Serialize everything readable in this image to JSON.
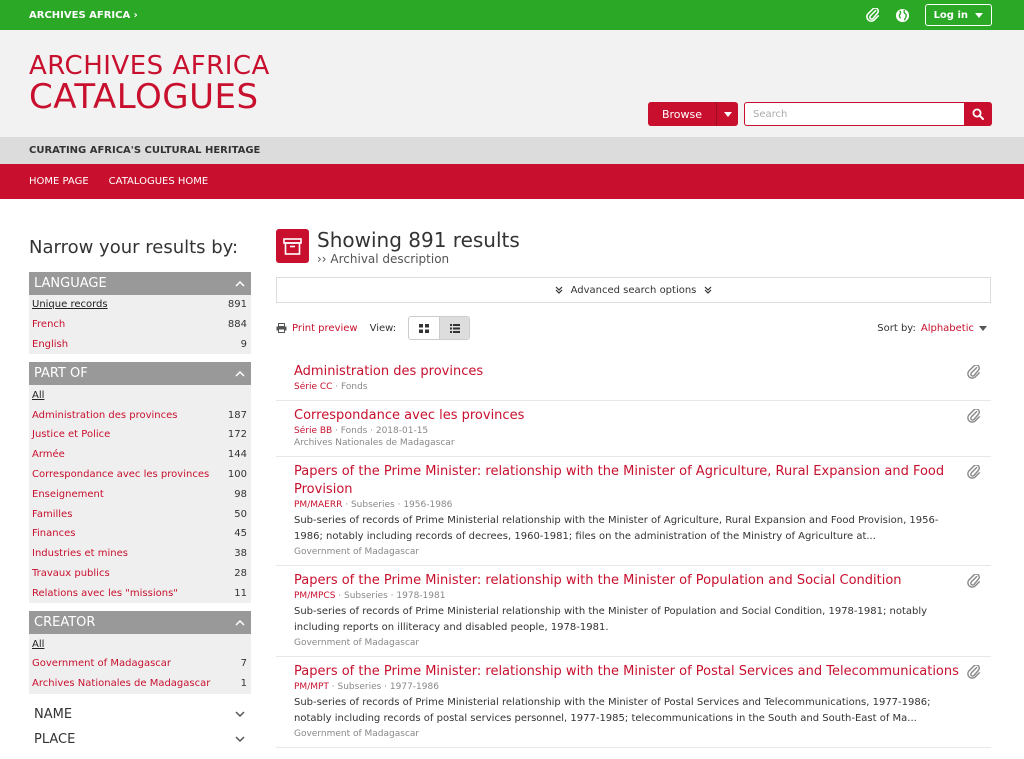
{
  "topbar": {
    "site": "ARCHIVES AFRICA ›",
    "login": "Log in"
  },
  "logo": {
    "line1": "ARCHIVES AFRICA",
    "line2": "CATALOGUES"
  },
  "browse": {
    "label": "Browse"
  },
  "search": {
    "placeholder": "Search"
  },
  "tagline": "CURATING AFRICA'S CULTURAL HERITAGE",
  "nav": {
    "home": "HOME PAGE",
    "catalogues": "CATALOGUES HOME"
  },
  "sidebar": {
    "heading": "Narrow your results by:",
    "language": {
      "title": "LANGUAGE",
      "items": [
        {
          "label": "Unique records",
          "count": "891"
        },
        {
          "label": "French",
          "count": "884"
        },
        {
          "label": "English",
          "count": "9"
        }
      ]
    },
    "partof": {
      "title": "PART OF",
      "all": "All",
      "items": [
        {
          "label": "Administration des provinces",
          "count": "187"
        },
        {
          "label": "Justice et Police",
          "count": "172"
        },
        {
          "label": "Armée",
          "count": "144"
        },
        {
          "label": "Correspondance avec les provinces",
          "count": "100"
        },
        {
          "label": "Enseignement",
          "count": "98"
        },
        {
          "label": "Familles",
          "count": "50"
        },
        {
          "label": "Finances",
          "count": "45"
        },
        {
          "label": "Industries et mines",
          "count": "38"
        },
        {
          "label": "Travaux publics",
          "count": "28"
        },
        {
          "label": "Relations avec les \"missions\"",
          "count": "11"
        }
      ]
    },
    "creator": {
      "title": "CREATOR",
      "all": "All",
      "items": [
        {
          "label": "Government of Madagascar",
          "count": "7"
        },
        {
          "label": "Archives Nationales de Madagascar",
          "count": "1"
        }
      ]
    },
    "name": "NAME",
    "place": "PLACE"
  },
  "content": {
    "title": "Showing 891 results",
    "subtitle": "›› Archival description",
    "advanced": "Advanced search options",
    "print": "Print preview",
    "view": "View:",
    "sort_label": "Sort by:",
    "sort_value": "Alphabetic"
  },
  "results": [
    {
      "title": "Administration des provinces",
      "ref": "Série CC",
      "level": "Fonds",
      "date": "",
      "desc": "",
      "creator": ""
    },
    {
      "title": "Correspondance avec les provinces",
      "ref": "Série BB",
      "level": "Fonds",
      "date": "2018-01-15",
      "desc": "",
      "creator": "Archives Nationales de Madagascar"
    },
    {
      "title": "Papers of the Prime Minister: relationship with the Minister of Agriculture, Rural Expansion and Food Provision",
      "ref": "PM/MAERR",
      "level": "Subseries",
      "date": "1956-1986",
      "desc": "Sub-series of records of Prime Ministerial relationship with the Minister of Agriculture, Rural Expansion and Food Provision, 1956-1986; notably including records of decrees, 1960-1981; files on the administration of the Ministry of Agriculture at...",
      "creator": "Government of Madagascar"
    },
    {
      "title": "Papers of the Prime Minister: relationship with the Minister of Population and Social Condition",
      "ref": "PM/MPCS",
      "level": "Subseries",
      "date": "1978-1981",
      "desc": "Sub-series of records of Prime Ministerial relationship with the Minister of Population and Social Condition, 1978-1981; notably including reports on illiteracy and disabled people, 1978-1981.",
      "creator": "Government of Madagascar"
    },
    {
      "title": "Papers of the Prime Minister: relationship with the Minister of Postal Services and Telecommunications",
      "ref": "PM/MPT",
      "level": "Subseries",
      "date": "1977-1986",
      "desc": "Sub-series of records of Prime Ministerial relationship with the Minister of Postal Services and Telecommunications, 1977-1986; notably including records of postal services personnel, 1977-1985; telecommunications in the South and South-East of Ma...",
      "creator": "Government of Madagascar"
    }
  ]
}
